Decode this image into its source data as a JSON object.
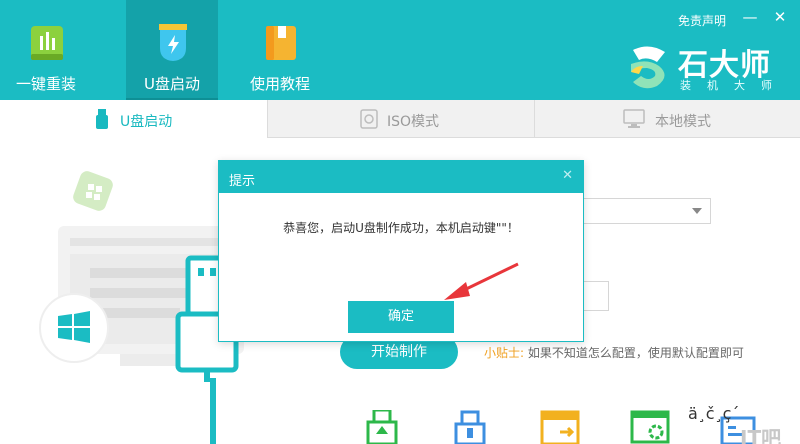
{
  "header": {
    "nav": [
      {
        "label": "一键重装",
        "icon": "chart-bars-icon"
      },
      {
        "label": "U盘启动",
        "icon": "usb-bolt-icon"
      },
      {
        "label": "使用教程",
        "icon": "book-icon"
      }
    ],
    "disclaimer": "免责声明",
    "window_controls": {
      "minimize": "—",
      "close": "✕"
    },
    "brand": {
      "name": "石大师",
      "sub": "装机大师"
    }
  },
  "tabs": [
    {
      "label": "U盘启动",
      "icon": "usb-icon"
    },
    {
      "label": "ISO模式",
      "icon": "disc-icon"
    },
    {
      "label": "本地模式",
      "icon": "monitor-icon"
    }
  ],
  "main": {
    "start_button": "开始制作",
    "tip_label": "小贴士:",
    "tip_text": "如果不知道怎么配置，使用默认配置即可",
    "garbled_text": "ä¸č¸ç´",
    "watermark": "IT吧"
  },
  "modal": {
    "title": "提示",
    "close": "✕",
    "message": "恭喜您，启动U盘制作成功，本机启动键\"\"！",
    "ok_button": "确定"
  },
  "colors": {
    "accent": "#1bbcc3",
    "accent_dark": "#14a2a9",
    "arrow": "#e8363b",
    "tip_label": "#f0a020"
  }
}
